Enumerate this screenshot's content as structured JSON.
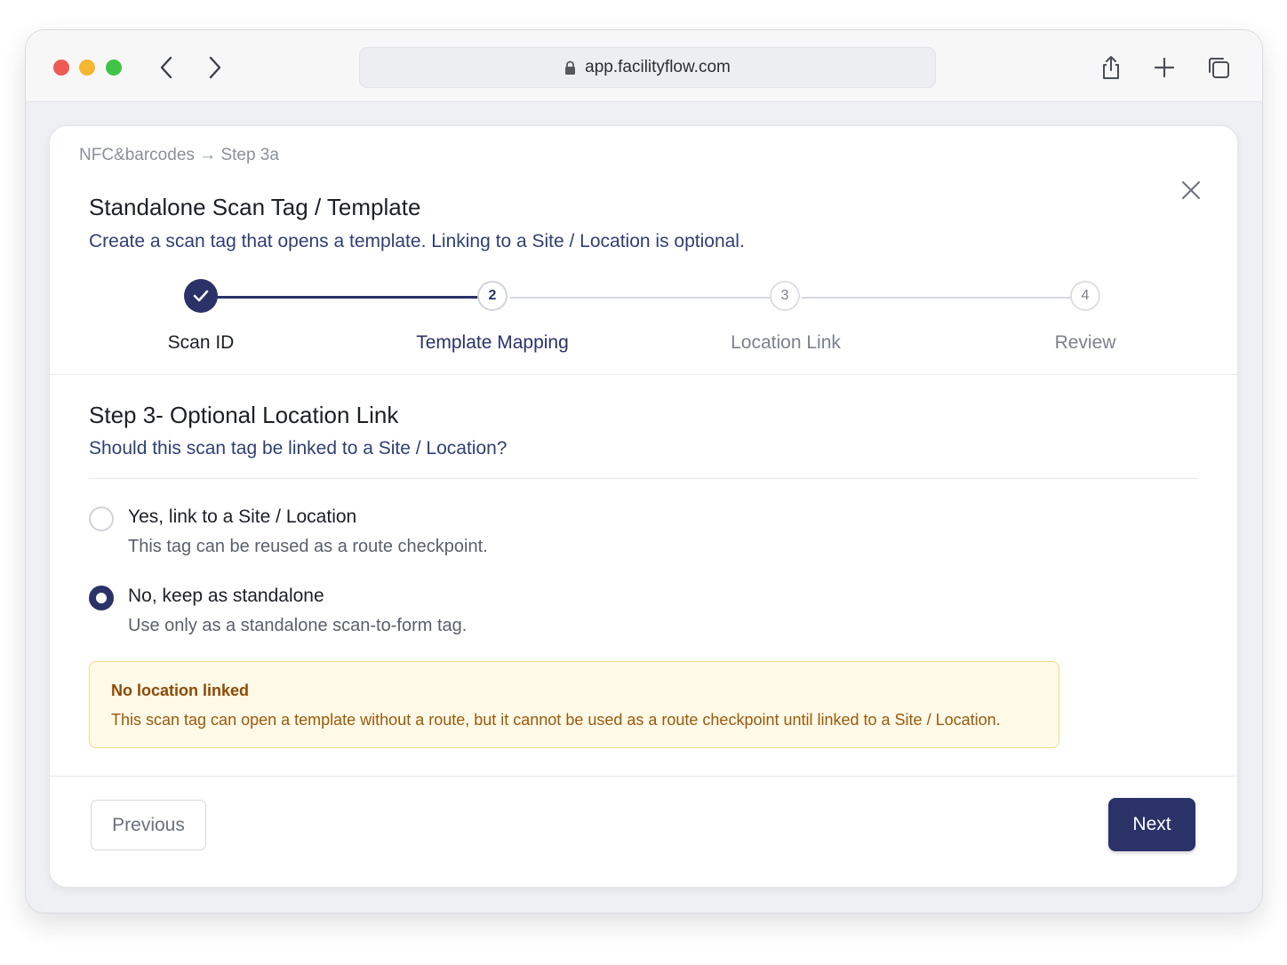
{
  "browser": {
    "url": "app.facilityflow.com"
  },
  "breadcrumb": "NFC&barcodes → Step 3a",
  "header": {
    "title": "Standalone Scan Tag / Template",
    "subtitle": "Create a scan tag that opens a template. Linking to a Site / Location is optional."
  },
  "stepper": {
    "steps": [
      {
        "number": "1",
        "label": "Scan ID",
        "state": "complete"
      },
      {
        "number": "2",
        "label": "Template Mapping",
        "state": "current"
      },
      {
        "number": "3",
        "label": "Location Link",
        "state": "upcoming"
      },
      {
        "number": "4",
        "label": "Review",
        "state": "upcoming"
      }
    ]
  },
  "section": {
    "title": "Step 3- Optional Location Link",
    "question": "Should this scan tag be linked to a Site / Location?"
  },
  "options": [
    {
      "label": "Yes, link to a Site / Location",
      "description": "This tag can be reused as a route checkpoint.",
      "selected": false
    },
    {
      "label": "No, keep as standalone",
      "description": "Use only as a standalone scan-to-form tag.",
      "selected": true
    }
  ],
  "alert": {
    "title": "No location linked",
    "text": "This scan tag can open a template without a route, but it cannot be used as a route checkpoint until linked to a Site / Location."
  },
  "footer": {
    "previous_label": "Previous",
    "next_label": "Next"
  },
  "colors": {
    "primary": "#2a3268",
    "warning_bg": "#fff9e8",
    "warning_text": "#9a5a0a"
  }
}
